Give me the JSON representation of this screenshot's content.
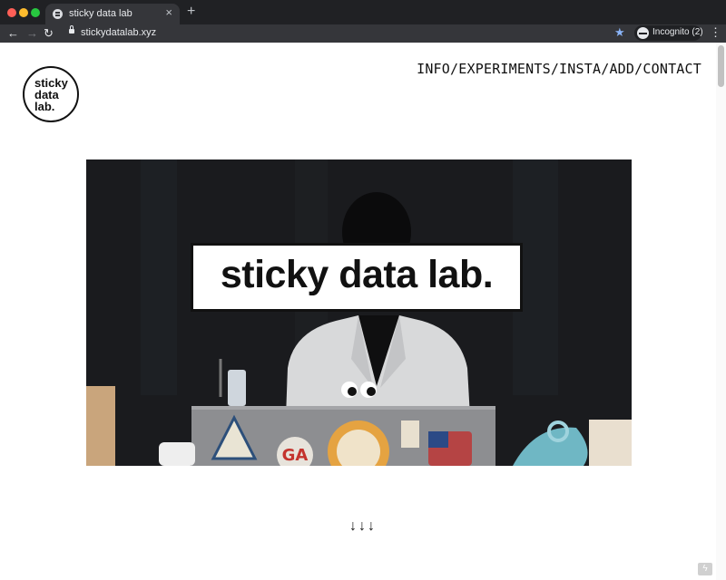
{
  "browser": {
    "tab_title": "sticky data lab",
    "url": "stickydatalab.xyz",
    "incognito_label": "Incognito (2)",
    "icons": [
      "back-icon",
      "forward-icon",
      "reload-icon",
      "lock-icon",
      "star-icon",
      "incognito-icon",
      "menu-icon"
    ]
  },
  "logo": {
    "line1": "sticky",
    "line2": "data",
    "line3": "lab."
  },
  "nav": {
    "items": [
      {
        "label": "INFO"
      },
      {
        "label": "EXPERIMENTS"
      },
      {
        "label": "INSTA"
      },
      {
        "label": "ADD"
      },
      {
        "label": "CONTACT"
      }
    ],
    "separator": "/"
  },
  "hero": {
    "title": "sticky data lab."
  },
  "scroll_hint": "↓↓↓"
}
